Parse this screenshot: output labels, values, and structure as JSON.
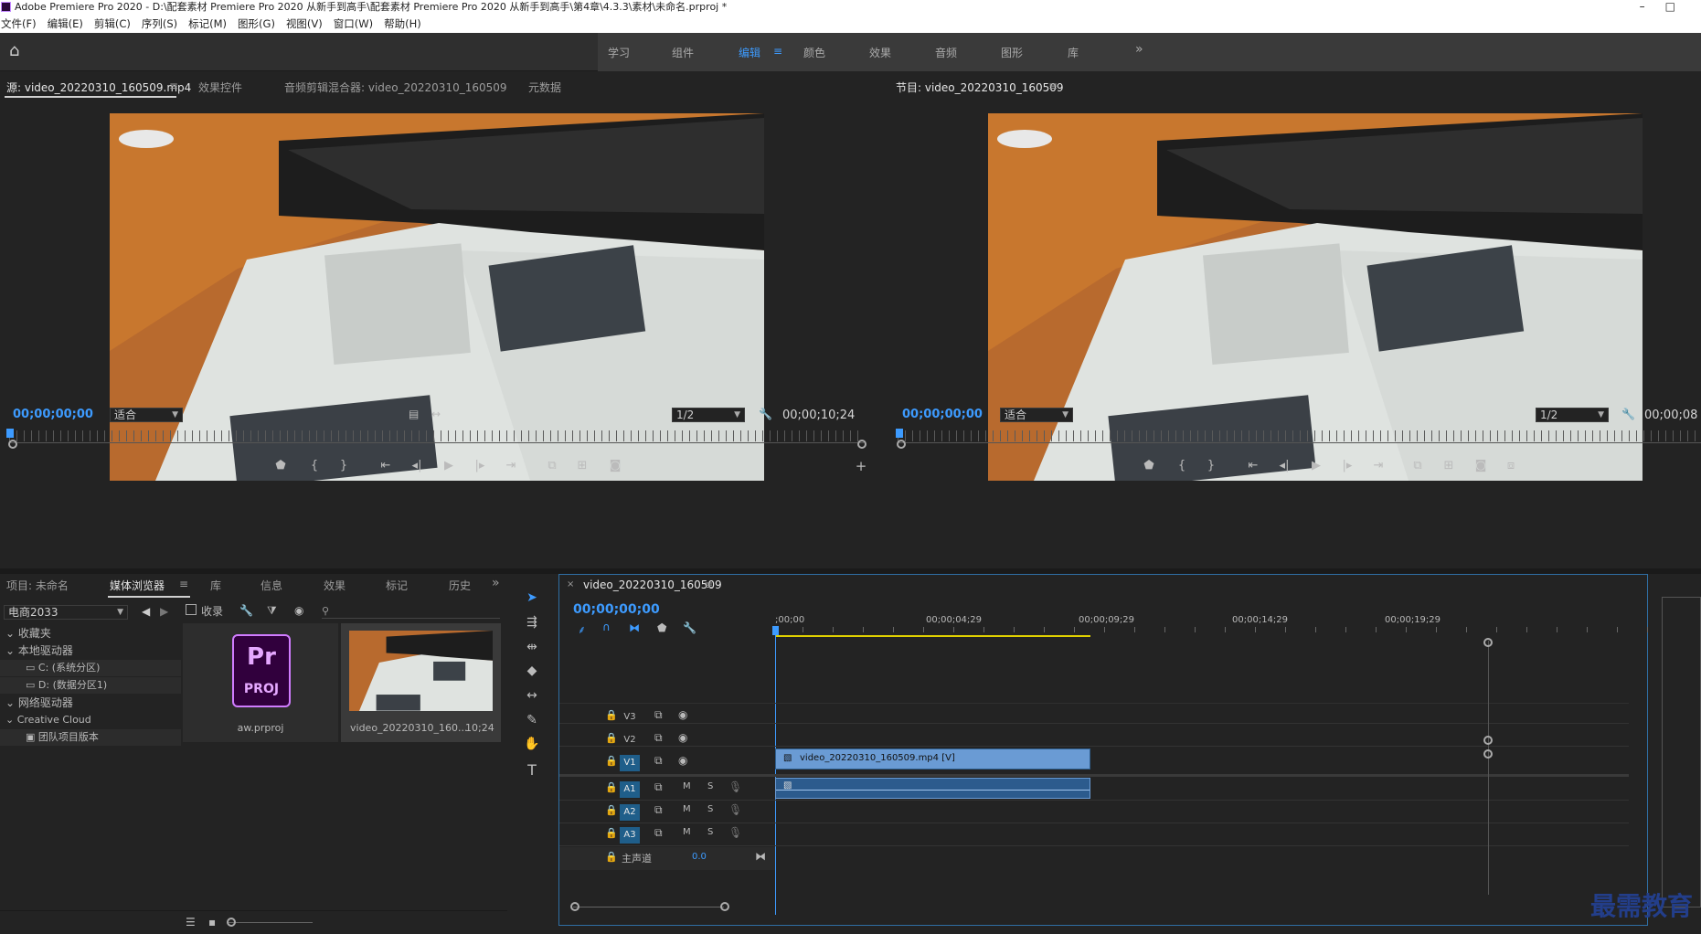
{
  "titlebar": {
    "title": "Adobe Premiere Pro 2020 - D:\\配套素材 Premiere Pro 2020 从新手到高手\\配套素材 Premiere Pro 2020 从新手到高手\\第4章\\4.3.3\\素材\\未命名.prproj *"
  },
  "menu": [
    "文件(F)",
    "编辑(E)",
    "剪辑(C)",
    "序列(S)",
    "标记(M)",
    "图形(G)",
    "视图(V)",
    "窗口(W)",
    "帮助(H)"
  ],
  "workspaces": [
    "学习",
    "组件",
    "编辑",
    "颜色",
    "效果",
    "音频",
    "图形",
    "库"
  ],
  "workspace_menu_icon": "≡",
  "source_panel": {
    "tabs": [
      "源: video_20220310_160509.mp4",
      "效果控件",
      "音频剪辑混合器: video_20220310_160509",
      "元数据"
    ],
    "timecode": "00;00;00;00",
    "fit": "适合",
    "resolution": "1/2",
    "duration": "00;00;10;24"
  },
  "program_panel": {
    "tab": "节目: video_20220310_160509",
    "timecode": "00;00;00;00",
    "fit": "适合",
    "resolution": "1/2",
    "duration": "00;00;08"
  },
  "project_panel": {
    "tabs": [
      "项目: 未命名",
      "媒体浏览器",
      "库",
      "信息",
      "效果",
      "标记",
      "历史"
    ],
    "location": "电商2033",
    "ingest_label": "收录",
    "tree": [
      {
        "label": "收藏夹",
        "level": 0
      },
      {
        "label": "本地驱动器",
        "level": 0
      },
      {
        "label": "C: (系统分区)",
        "level": 1
      },
      {
        "label": "D: (数据分区1)",
        "level": 1
      },
      {
        "label": "网络驱动器",
        "level": 0
      },
      {
        "label": "Creative Cloud",
        "level": 0
      },
      {
        "label": "团队项目版本",
        "level": 1
      }
    ],
    "items": [
      {
        "name": "aw.prproj",
        "badge_top": "Pr",
        "badge_bottom": "PROJ"
      },
      {
        "name": "video_20220310_160...",
        "duration": "10;24"
      }
    ]
  },
  "timeline": {
    "tab": "video_20220310_160509",
    "timecode": "00;00;00;00",
    "ruler": [
      ";00;00",
      "00;00;04;29",
      "00;00;09;29",
      "00;00;14;29",
      "00;00;19;29"
    ],
    "video_tracks": [
      "V3",
      "V2",
      "V1"
    ],
    "audio_tracks": [
      "A1",
      "A2",
      "A3"
    ],
    "mute": "M",
    "solo": "S",
    "master_label": "主声道",
    "master_value": "0.0",
    "clip_label": "video_20220310_160509.mp4 [V]"
  },
  "watermark": "最需教育",
  "colors": {
    "accent": "#3d9bff",
    "clip_blue": "#6a9bd4",
    "track_on": "#1f5e8a"
  }
}
